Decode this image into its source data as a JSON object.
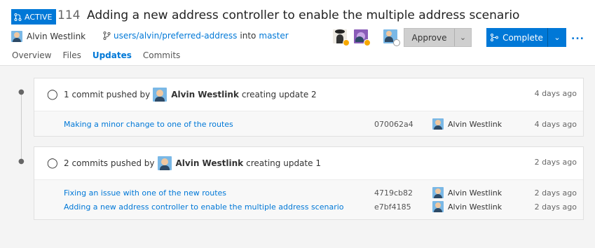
{
  "pr": {
    "status": "ACTIVE",
    "number": "114",
    "title": "Adding a new address controller to enable the multiple address scenario",
    "author": "Alvin Westlink",
    "source_branch": "users/alvin/preferred-address",
    "into": "into",
    "target_branch": "master"
  },
  "actions": {
    "approve": "Approve",
    "complete": "Complete",
    "more": "..."
  },
  "tabs": [
    {
      "label": "Overview"
    },
    {
      "label": "Files"
    },
    {
      "label": "Updates"
    },
    {
      "label": "Commits"
    }
  ],
  "updates": [
    {
      "summary_prefix": "1 commit pushed by",
      "author": "Alvin Westlink",
      "summary_suffix": "creating update 2",
      "time": "4 days ago",
      "commits": [
        {
          "message": "Making a minor change to one of the routes",
          "hash": "070062a4",
          "author": "Alvin Westlink",
          "time": "4 days ago"
        }
      ]
    },
    {
      "summary_prefix": "2 commits pushed by",
      "author": "Alvin Westlink",
      "summary_suffix": "creating update 1",
      "time": "2 days ago",
      "commits": [
        {
          "message": "Fixing an issue with one of the new routes",
          "hash": "4719cb82",
          "author": "Alvin Westlink",
          "time": "2 days ago"
        },
        {
          "message": "Adding a new address controller to enable the multiple address scenario",
          "hash": "e7bf4185",
          "author": "Alvin Westlink",
          "time": "2 days ago"
        }
      ]
    }
  ],
  "colors": {
    "accent": "#0078d7",
    "pending": "#f7a800"
  }
}
